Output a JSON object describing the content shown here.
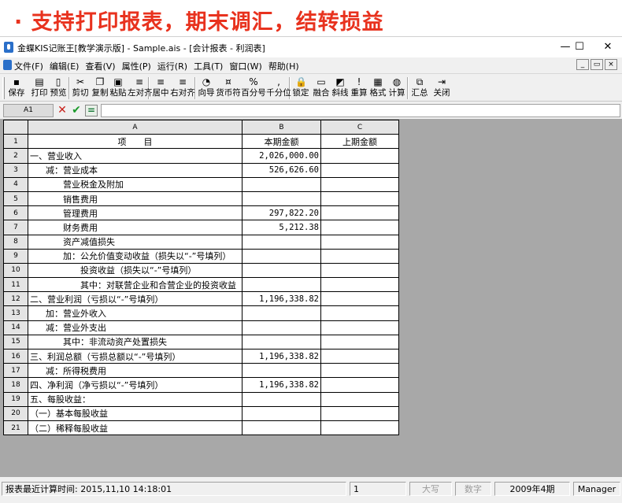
{
  "banner": {
    "text": "· 支持打印报表，期末调汇，结转损益"
  },
  "window": {
    "title": "金蝶KIS记账王[教学演示版] - Sample.ais - [会计报表 - 利润表]",
    "controls": {
      "minimize": "—",
      "maximize": "☐",
      "close": "✕"
    }
  },
  "menu": {
    "items": [
      "文件(F)",
      "编辑(E)",
      "查看(V)",
      "属性(P)",
      "运行(R)",
      "工具(T)",
      "窗口(W)",
      "帮助(H)"
    ],
    "mdi": {
      "minimize": "_",
      "restore": "▭",
      "close": "×"
    }
  },
  "toolbar": {
    "buttons": [
      {
        "label": "保存",
        "icon": "save-icon",
        "glyph": "▪"
      },
      {
        "label": "打印",
        "icon": "print-icon",
        "glyph": "▤"
      },
      {
        "label": "预览",
        "icon": "preview-icon",
        "glyph": "▯"
      },
      {
        "label": "剪切",
        "icon": "cut-icon",
        "glyph": "✂"
      },
      {
        "label": "复制",
        "icon": "copy-icon",
        "glyph": "❐"
      },
      {
        "label": "粘贴",
        "icon": "paste-icon",
        "glyph": "▣"
      },
      {
        "label": "左对齐",
        "icon": "align-left-icon",
        "glyph": "≡"
      },
      {
        "label": "居中",
        "icon": "align-center-icon",
        "glyph": "≡"
      },
      {
        "label": "右对齐",
        "icon": "align-right-icon",
        "glyph": "≡"
      },
      {
        "label": "向导",
        "icon": "wizard-icon",
        "glyph": "◔"
      },
      {
        "label": "货币符",
        "icon": "currency-icon",
        "glyph": "¤"
      },
      {
        "label": "百分号",
        "icon": "percent-icon",
        "glyph": "%"
      },
      {
        "label": "千分位",
        "icon": "comma-icon",
        "glyph": ","
      },
      {
        "label": "锁定",
        "icon": "lock-icon",
        "glyph": "🔒"
      },
      {
        "label": "融合",
        "icon": "merge-icon",
        "glyph": "▭"
      },
      {
        "label": "斜线",
        "icon": "diagonal-icon",
        "glyph": "◩"
      },
      {
        "label": "重算",
        "icon": "recalc-icon",
        "glyph": "!"
      },
      {
        "label": "格式",
        "icon": "format-icon",
        "glyph": "▦"
      },
      {
        "label": "计算",
        "icon": "calculate-icon",
        "glyph": "◍"
      },
      {
        "label": "汇总",
        "icon": "summary-icon",
        "glyph": "⧉"
      },
      {
        "label": "关闭",
        "icon": "close-doc-icon",
        "glyph": "⇥"
      }
    ]
  },
  "formula": {
    "cell_ref": "A1",
    "cancel": "✕",
    "confirm": "✔",
    "equals": "=",
    "value": ""
  },
  "sheet": {
    "columns": [
      "A",
      "B",
      "C"
    ],
    "header_row": {
      "num": "1",
      "item": "项　　目",
      "current": "本期金额",
      "previous": "上期金额"
    },
    "rows": [
      {
        "num": "2",
        "item": "一、营业收入",
        "current": "2,026,000.00",
        "previous": "",
        "indent": 0
      },
      {
        "num": "3",
        "item": "减：营业成本",
        "current": "526,626.60",
        "previous": "",
        "indent": 1
      },
      {
        "num": "4",
        "item": "营业税金及附加",
        "current": "",
        "previous": "",
        "indent": 2
      },
      {
        "num": "5",
        "item": "销售费用",
        "current": "",
        "previous": "",
        "indent": 2
      },
      {
        "num": "6",
        "item": "管理费用",
        "current": "297,822.20",
        "previous": "",
        "indent": 2
      },
      {
        "num": "7",
        "item": "财务费用",
        "current": "5,212.38",
        "previous": "",
        "indent": 2
      },
      {
        "num": "8",
        "item": "资产减值损失",
        "current": "",
        "previous": "",
        "indent": 2
      },
      {
        "num": "9",
        "item": "加：公允价值变动收益（损失以“-”号填列）",
        "current": "",
        "previous": "",
        "indent": 2
      },
      {
        "num": "10",
        "item": "投资收益（损失以“-”号填列）",
        "current": "",
        "previous": "",
        "indent": 3
      },
      {
        "num": "11",
        "item": "其中：对联营企业和合营企业的投资收益",
        "current": "",
        "previous": "",
        "indent": 3
      },
      {
        "num": "12",
        "item": "二、营业利润（亏损以“-”号填列）",
        "current": "1,196,338.82",
        "previous": "",
        "indent": 0
      },
      {
        "num": "13",
        "item": "加：营业外收入",
        "current": "",
        "previous": "",
        "indent": 1
      },
      {
        "num": "14",
        "item": "减：营业外支出",
        "current": "",
        "previous": "",
        "indent": 1
      },
      {
        "num": "15",
        "item": "其中：非流动资产处置损失",
        "current": "",
        "previous": "",
        "indent": 2
      },
      {
        "num": "16",
        "item": "三、利润总额（亏损总额以“-”号填列）",
        "current": "1,196,338.82",
        "previous": "",
        "indent": 0
      },
      {
        "num": "17",
        "item": "减：所得税费用",
        "current": "",
        "previous": "",
        "indent": 1
      },
      {
        "num": "18",
        "item": "四、净利润（净亏损以“-”号填列）",
        "current": "1,196,338.82",
        "previous": "",
        "indent": 0
      },
      {
        "num": "19",
        "item": "五、每股收益：",
        "current": "",
        "previous": "",
        "indent": 0
      },
      {
        "num": "20",
        "item": "（一）基本每股收益",
        "current": "",
        "previous": "",
        "indent": 0
      },
      {
        "num": "21",
        "item": "（二）稀释每股收益",
        "current": "",
        "previous": "",
        "indent": 0
      }
    ]
  },
  "status": {
    "last_calc": "报表最近计算时间: 2015,11,10 14:18:01",
    "page": "1",
    "caps": "大写",
    "num": "数字",
    "period": "2009年4期",
    "user": "Manager"
  },
  "colors": {
    "banner_text": "#e8321e",
    "sheet_bg": "#a8a8a8"
  }
}
